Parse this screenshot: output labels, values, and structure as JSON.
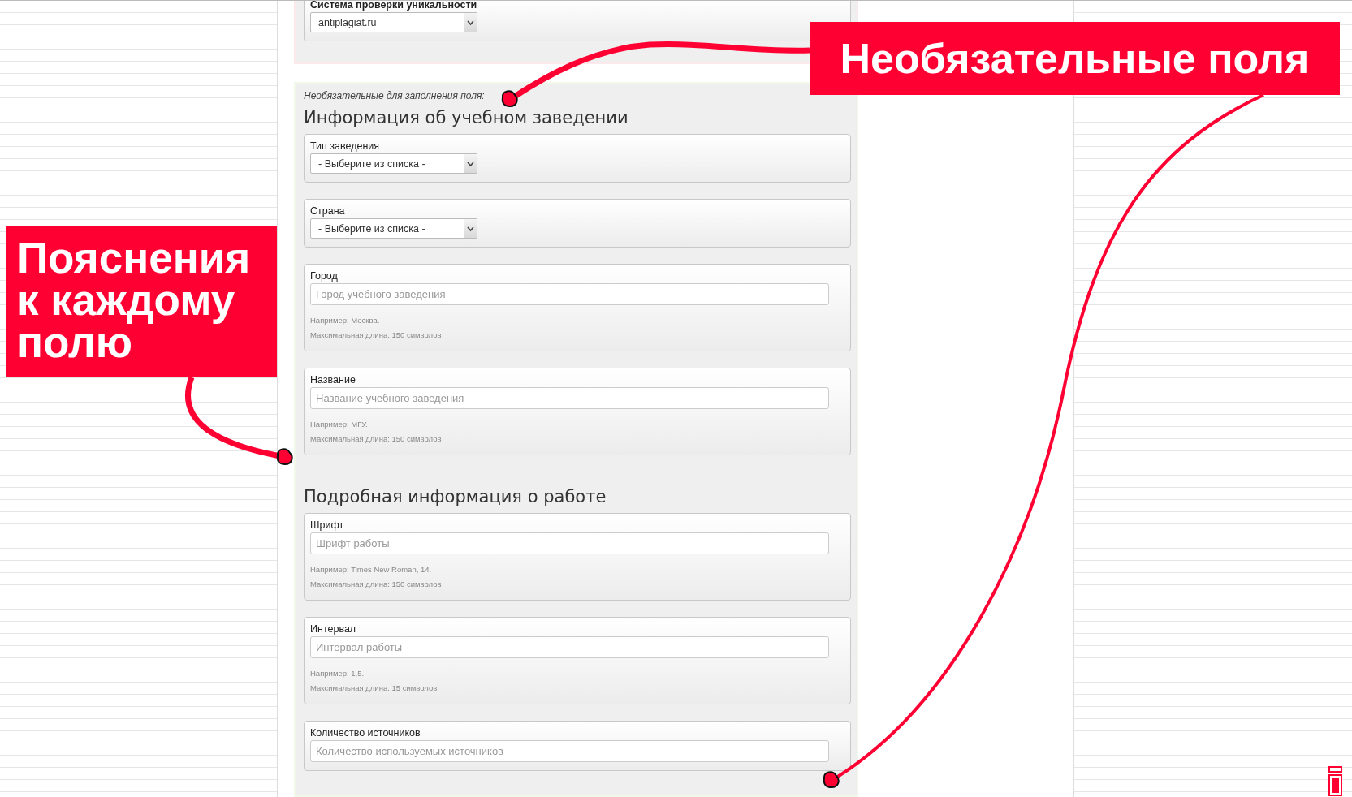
{
  "top_section": {
    "fields": [
      {
        "kind": "select",
        "label": "Система проверки уникальности",
        "value": "antiplagiat.ru"
      }
    ]
  },
  "optional_note": "Необязательные для заполнения поля:",
  "sections": [
    {
      "heading": "Информация об учебном заведении",
      "fields": [
        {
          "kind": "select",
          "label": "Тип заведения",
          "value": "- Выберите из списка -"
        },
        {
          "kind": "select",
          "label": "Страна",
          "value": "- Выберите из списка -"
        },
        {
          "kind": "text",
          "label": "Город",
          "placeholder": "Город учебного заведения",
          "hints": [
            "Например: Москва.",
            "Максимальная длина: 150 символов"
          ]
        },
        {
          "kind": "text",
          "label": "Название",
          "placeholder": "Название учебного заведения",
          "hints": [
            "Например: МГУ.",
            "Максимальная длина: 150 символов"
          ]
        }
      ]
    },
    {
      "heading": "Подробная информация о работе",
      "fields": [
        {
          "kind": "text",
          "label": "Шрифт",
          "placeholder": "Шрифт работы",
          "hints": [
            "Например: Times New Roman, 14.",
            "Максимальная длина: 150 символов"
          ]
        },
        {
          "kind": "text",
          "label": "Интервал",
          "placeholder": "Интервал работы",
          "hints": [
            "Например: 1,5.",
            "Максимальная длина: 15 символов"
          ]
        },
        {
          "kind": "text",
          "label": "Количество источников",
          "placeholder": "Количество используемых источников"
        }
      ]
    }
  ],
  "annotations": [
    {
      "text": "Необязательные поля"
    },
    {
      "text": "Пояснения к каждому полю"
    }
  ]
}
